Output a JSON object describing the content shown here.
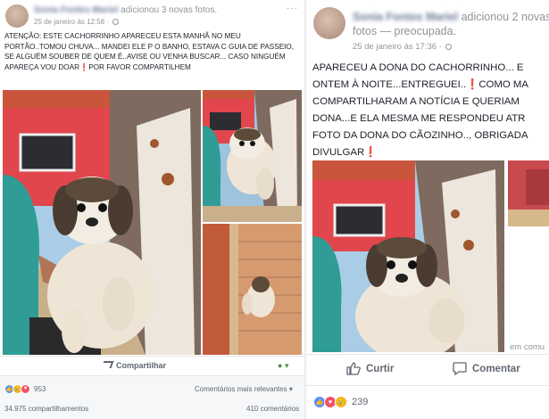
{
  "left_post": {
    "author": "Sonia Fontes Mariel",
    "action": "adicionou 3 novas fotos.",
    "date": "25 de janeiro às 12:58 ·",
    "menu": "···",
    "text": "ATENÇÃO: ESTE CACHORRINHO APARECEU ESTA MANHÃ NO MEU PORTÃO..TOMOU CHUVA... MANDEI ELE P O BANHO, ESTAVA C GUIA DE PASSEIO, SE ALGUÉM SOUBER DE QUEM É..AVISE OU VENHA BUSCAR... CASO NINGUÉM APAREÇA VOU DOAR❗️POR FAVOR COMPARTILHEM",
    "share_label": "Compartilhar",
    "audience_icon": "globe-icon",
    "reaction_count": "953",
    "comments_label": "Comentários mais relevantes ▾",
    "shares": "34.975 compartilhamentos",
    "comments_count": "410 comentários"
  },
  "right_post": {
    "author": "Sonia Fontes Mariel",
    "action": "adicionou 2 novas fotos — preocupada.",
    "date": "25 de janeiro às 17:36 ·",
    "text_lines": [
      "APARECEU A DONA DO CACHORRINHO... E",
      "ONTEM À NOITE...ENTREGUEI..❗️COMO MA",
      "COMPARTILHARAM A NOTÍCIA E QUERIAM",
      "DONA...E ELA MESMA ME RESPONDEU ATR",
      "FOTO DA DONA DO CÃOZINHO.., OBRIGADA",
      "DIVULGAR❗️"
    ],
    "side_link": "em comu",
    "like_label": "Curtir",
    "comment_label": "Comentar",
    "reaction_count": "239"
  },
  "colors": {
    "facebook_blue": "#4267b2",
    "text_primary": "#1d2129",
    "text_secondary": "#90949c",
    "like_blue": "#5890ff",
    "love_red": "#f25268",
    "sad_yellow": "#f7b125"
  }
}
